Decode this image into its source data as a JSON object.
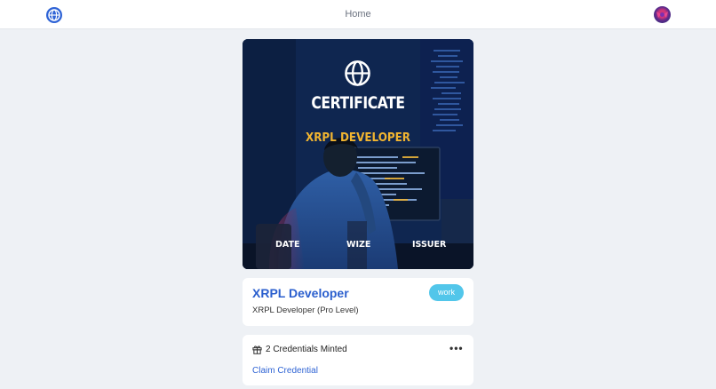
{
  "header": {
    "home_label": "Home",
    "logo_icon": "globe-icon",
    "avatar_icon": "user-avatar"
  },
  "certificate": {
    "icon": "globe-icon",
    "title": "CERTIFICATE",
    "subtitle": "XRPL DEVELOPER",
    "footer_left": "DATE",
    "footer_center": "WIZE",
    "footer_right": "ISSUER"
  },
  "details": {
    "title": "XRPL Developer",
    "description": "XRPL Developer (Pro Level)",
    "tag": "work"
  },
  "credentials": {
    "minted_text": "2 Credentials Minted",
    "minted_icon": "gift-icon",
    "more_icon": "more-horizontal-icon",
    "more_text": "•••",
    "claim_label": "Claim Credential"
  },
  "colors": {
    "accent": "#2b5fce",
    "badge": "#52c6ea",
    "certificate_subtitle": "#f2b530",
    "background": "#eef1f5"
  }
}
